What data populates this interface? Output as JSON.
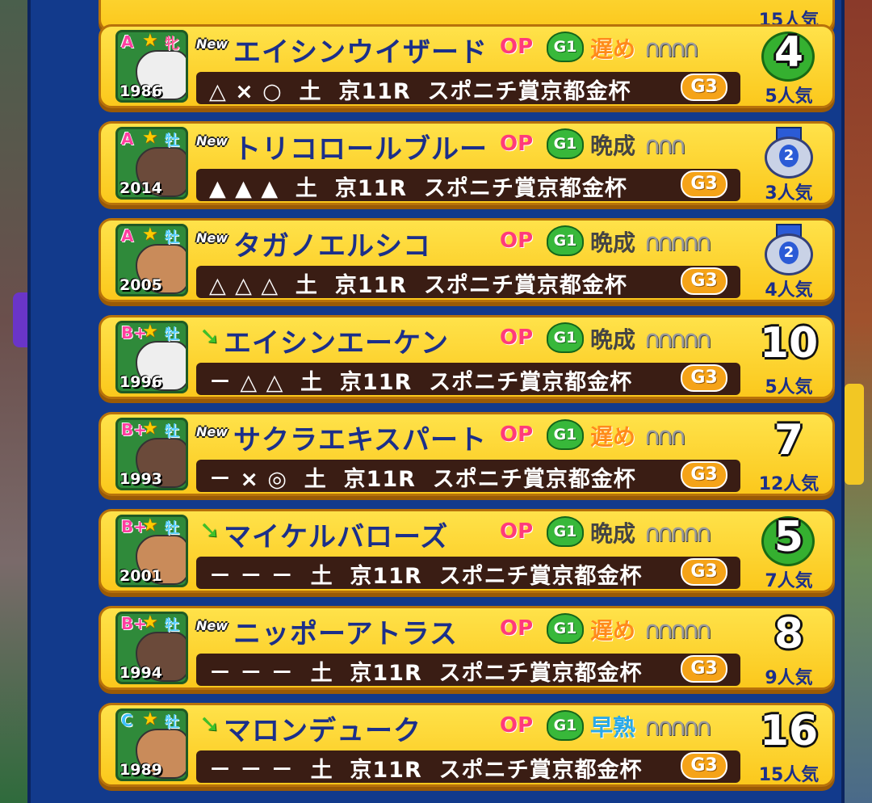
{
  "colors": {
    "panel": "#123a8c",
    "card": "#fbc81c",
    "name": "#1b2f8a",
    "op": "#ff3b7a",
    "bar": "#3a1d14"
  },
  "partial_card": {
    "popularity": "15人気"
  },
  "horses": [
    {
      "rank": "A",
      "sex": "牝",
      "year": "1986",
      "tag": "New",
      "name": "エイシンウイザード",
      "op": "OP",
      "g1": "G1",
      "growth": "遅め",
      "growth_type": "late",
      "shoes": 4,
      "race": "△ × ○  土  京11R  スポニチ賞京都金杯",
      "grade": "G3",
      "finish": "4",
      "finish_style": "laurel",
      "popularity": "5人気"
    },
    {
      "rank": "A",
      "sex": "牡",
      "year": "2014",
      "tag": "New",
      "name": "トリコロールブルー",
      "op": "OP",
      "g1": "G1",
      "growth": "晩成",
      "growth_type": "normal",
      "shoes": 3,
      "race": "▲ ▲ ▲  土  京11R  スポニチ賞京都金杯",
      "grade": "G3",
      "finish": "2",
      "finish_style": "medal",
      "popularity": "3人気"
    },
    {
      "rank": "A",
      "sex": "牡",
      "year": "2005",
      "tag": "New",
      "name": "タガノエルシコ",
      "op": "OP",
      "g1": "G1",
      "growth": "晩成",
      "growth_type": "normal",
      "shoes": 5,
      "race": "△ △ △  土  京11R  スポニチ賞京都金杯",
      "grade": "G3",
      "finish": "2",
      "finish_style": "medal",
      "popularity": "4人気"
    },
    {
      "rank": "B+",
      "sex": "牡",
      "year": "1996",
      "tag": "down",
      "name": "エイシンエーケン",
      "op": "OP",
      "g1": "G1",
      "growth": "晩成",
      "growth_type": "normal",
      "shoes": 5,
      "race": "－ △ △  土  京11R  スポニチ賞京都金杯",
      "grade": "G3",
      "finish": "10",
      "finish_style": "plain",
      "popularity": "5人気"
    },
    {
      "rank": "B+",
      "sex": "牡",
      "year": "1993",
      "tag": "New",
      "name": "サクラエキスパート",
      "op": "OP",
      "g1": "G1",
      "growth": "遅め",
      "growth_type": "late",
      "shoes": 3,
      "race": "－ × ◎  土  京11R  スポニチ賞京都金杯",
      "grade": "G3",
      "finish": "7",
      "finish_style": "plain",
      "popularity": "12人気"
    },
    {
      "rank": "B+",
      "sex": "牡",
      "year": "2001",
      "tag": "down",
      "name": "マイケルバローズ",
      "op": "OP",
      "g1": "G1",
      "growth": "晩成",
      "growth_type": "normal",
      "shoes": 5,
      "race": "－ － －  土  京11R  スポニチ賞京都金杯",
      "grade": "G3",
      "finish": "5",
      "finish_style": "laurel",
      "popularity": "7人気"
    },
    {
      "rank": "B+",
      "sex": "牡",
      "year": "1994",
      "tag": "New",
      "name": "ニッポーアトラス",
      "op": "OP",
      "g1": "G1",
      "growth": "遅め",
      "growth_type": "late",
      "shoes": 5,
      "race": "－ － －  土  京11R  スポニチ賞京都金杯",
      "grade": "G3",
      "finish": "8",
      "finish_style": "plain",
      "popularity": "9人気"
    },
    {
      "rank": "C",
      "sex": "牡",
      "year": "1989",
      "tag": "down",
      "name": "マロンデューク",
      "op": "OP",
      "g1": "G1",
      "growth": "早熟",
      "growth_type": "early",
      "shoes": 5,
      "race": "－ － －  土  京11R  スポニチ賞京都金杯",
      "grade": "G3",
      "finish": "16",
      "finish_style": "plain",
      "popularity": "15人気"
    }
  ]
}
